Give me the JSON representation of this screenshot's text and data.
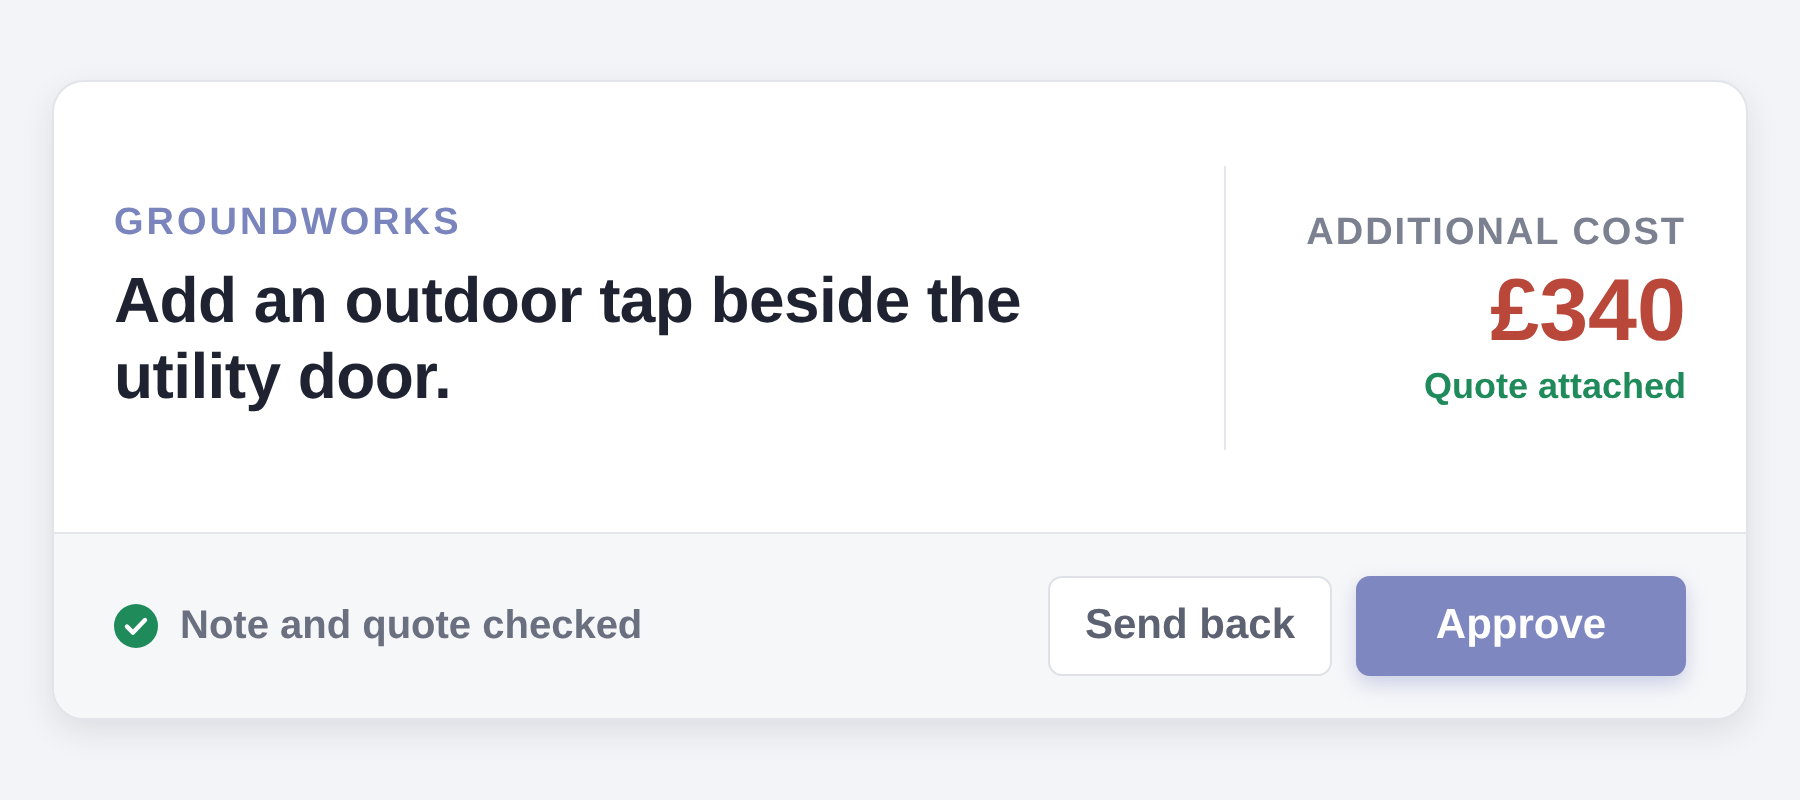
{
  "category": "GROUNDWORKS",
  "title": "Add an outdoor tap beside the utility door.",
  "cost": {
    "label": "ADDITIONAL COST",
    "amount": "£340",
    "note": "Quote attached"
  },
  "status": {
    "label": "Note and quote checked",
    "checked": true
  },
  "buttons": [
    {
      "label": "Send back",
      "kind": "secondary"
    },
    {
      "label": "Approve",
      "kind": "primary"
    }
  ]
}
